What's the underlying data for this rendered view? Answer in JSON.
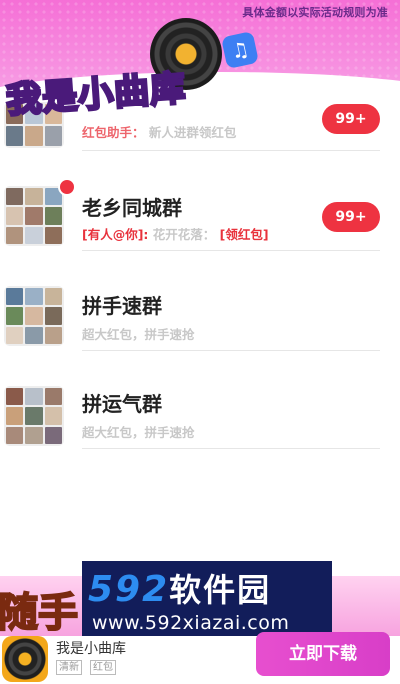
{
  "header": {
    "disclaimer": "具体金额以实际活动规则为准",
    "logo_text": "我是小曲库"
  },
  "groups": [
    {
      "title": "",
      "sub_prefix": "红包助手：",
      "sub_text": "新人进群领红包",
      "sub_suffix": "",
      "badge": "99+",
      "unread_dot": false
    },
    {
      "title": "老乡同城群",
      "sub_prefix": "[有人@你]:",
      "sub_text": "花开花落：",
      "sub_suffix": "[领红包]",
      "badge": "99+",
      "unread_dot": true
    },
    {
      "title": "拼手速群",
      "sub_prefix": "",
      "sub_text": "超大红包，拼手速抢",
      "sub_suffix": "",
      "badge": "",
      "unread_dot": false
    },
    {
      "title": "拼运气群",
      "sub_prefix": "",
      "sub_text": "超大红包，拼手速抢",
      "sub_suffix": "",
      "badge": "",
      "unread_dot": false
    }
  ],
  "promo": {
    "partial_text": "随手"
  },
  "watermark": {
    "logo_digits": "592",
    "logo_cn": "软件园",
    "url": "www.592xiazai.com"
  },
  "ad": {
    "app_name": "我是小曲库",
    "tags": [
      "清新",
      "红包"
    ],
    "download_label": "立即下载"
  },
  "colors": {
    "banner_pink": "#f56fd6",
    "badge_red": "#ee3341",
    "download_pink": "#e74fcf",
    "watermark_navy": "#121d5a"
  }
}
